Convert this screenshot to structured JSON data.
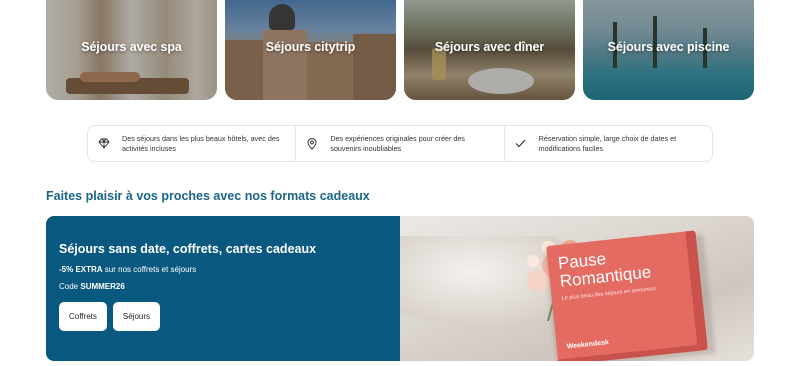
{
  "categories": [
    {
      "label": "Séjours avec spa"
    },
    {
      "label": "Séjours citytrip"
    },
    {
      "label": "Séjours avec dîner"
    },
    {
      "label": "Séjours avec piscine"
    }
  ],
  "features": [
    {
      "icon": "diamond-icon",
      "text": "Des séjours dans les plus beaux hôtels, avec des activités incluses"
    },
    {
      "icon": "location-pin-icon",
      "text": "Des expériences originales pour créer des souvenirs inoubliables"
    },
    {
      "icon": "checkmark-icon",
      "text": "Réservation simple, large choix de dates et modifications faciles"
    }
  ],
  "gifts_section": {
    "title": "Faites plaisir à vos proches avec nos formats cadeaux"
  },
  "promo": {
    "title": "Séjours sans date, coffrets, cartes cadeaux",
    "discount_bold": "-5% EXTRA",
    "discount_rest": " sur nos coffrets et séjours",
    "code_label": "Code ",
    "code_value": "SUMMER26",
    "buttons": [
      "Coffrets",
      "Séjours"
    ],
    "box_title": "Pause Romantique",
    "box_subtitle": "Le plus beau des séjours en amoureux.",
    "box_logo": "Weekendesk",
    "background_color": "#09587f"
  },
  "colors": {
    "accent": "#1b6589",
    "promo_bg": "#09587f",
    "gift_box": "#e46b62"
  }
}
